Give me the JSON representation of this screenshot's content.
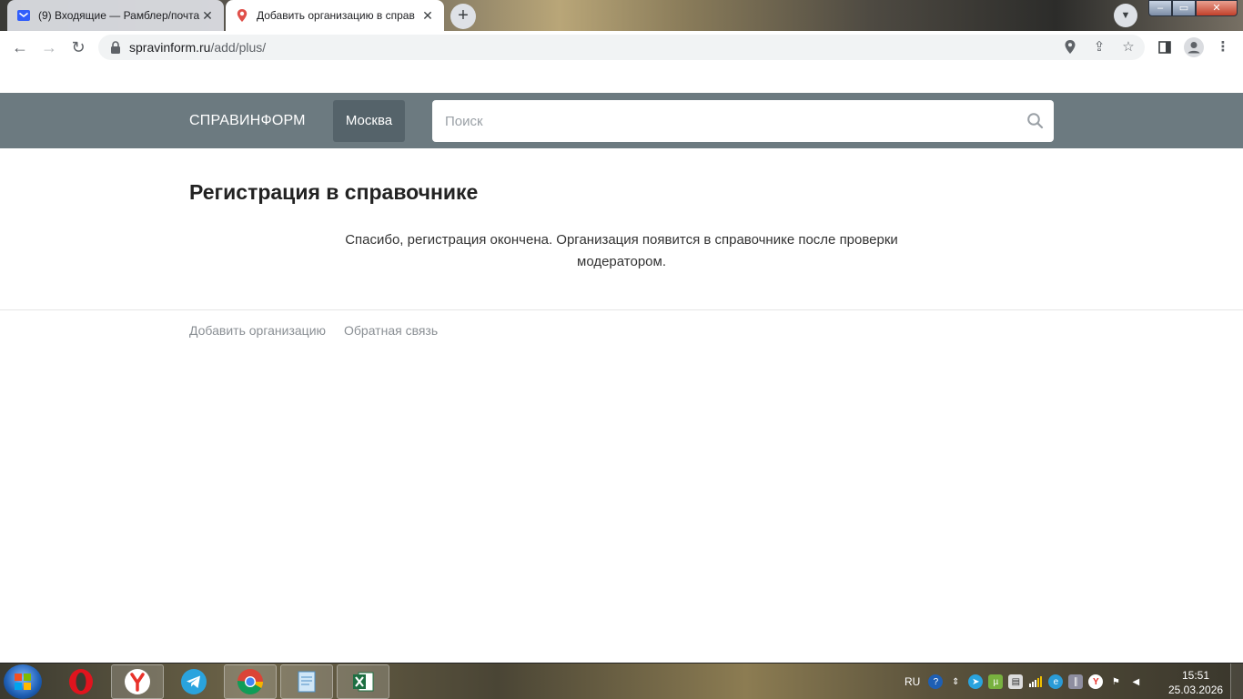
{
  "browser": {
    "tabs": [
      {
        "title": "(9) Входящие — Рамблер/почта",
        "icon": "mail-icon",
        "active": false
      },
      {
        "title": "Добавить организацию в справ",
        "icon": "map-pin-icon",
        "active": true
      }
    ],
    "new_tab_label": "+",
    "url_host": "spravinform.ru",
    "url_path": "/add/plus/"
  },
  "site": {
    "brand": "СПРАВИНФОРМ",
    "city_button": "Москва",
    "search_placeholder": "Поиск",
    "colors": {
      "header_bg": "#6c7a80",
      "city_bg": "#55636a"
    }
  },
  "main": {
    "title": "Регистрация в справочнике",
    "message": "Спасибо, регистрация окончена. Организация появится в справочнике после проверки модератором."
  },
  "footer": {
    "links": [
      "Добавить организацию",
      "Обратная связь"
    ]
  },
  "taskbar": {
    "pinned_apps": [
      "opera-icon",
      "yandex-browser-icon",
      "telegram-icon",
      "chrome-icon",
      "notepad-icon",
      "excel-icon"
    ],
    "language": "RU",
    "time": "15:51",
    "date": "25.03.2026"
  }
}
